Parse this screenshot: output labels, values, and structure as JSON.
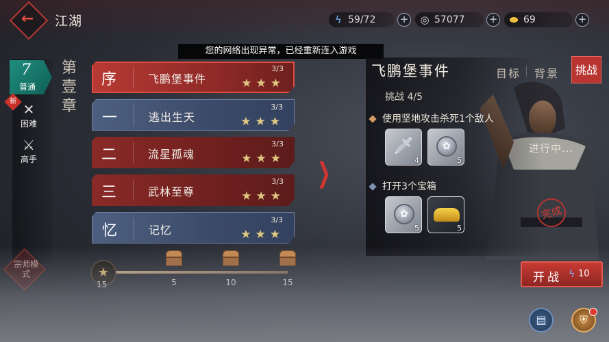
{
  "header": {
    "title": "江湖",
    "energy": "59/72",
    "coins": "57077",
    "gold": "69"
  },
  "notice": "您的网络出现异常，已经重新连入游戏",
  "difficulty": {
    "normal": "普通",
    "hard": "困难",
    "expert": "高手",
    "new_badge": "新"
  },
  "chapter_title": "第壹章",
  "master_mode": "宗师模式",
  "stages": [
    {
      "num": "序",
      "name": "飞鹏堡事件",
      "progress": "3/3",
      "stars": "★★★"
    },
    {
      "num": "一",
      "name": "逃出生天",
      "progress": "3/3",
      "stars": "★★★"
    },
    {
      "num": "二",
      "name": "流星孤魂",
      "progress": "3/3",
      "stars": "★★★"
    },
    {
      "num": "三",
      "name": "武林至尊",
      "progress": "3/3",
      "stars": "★★★"
    },
    {
      "num": "忆",
      "name": "记忆",
      "progress": "3/3",
      "stars": "★★★"
    }
  ],
  "star_progress": {
    "current": "15",
    "milestones": [
      "5",
      "10",
      "15"
    ]
  },
  "detail": {
    "title": "飞鹏堡事件",
    "tabs": {
      "goal": "目标",
      "background": "背景",
      "challenge": "挑战"
    },
    "challenge_label": "挑战",
    "challenge_count": "4/5",
    "goals": [
      {
        "text": "使用坚地攻击杀死1个敌人",
        "rewards": [
          "4",
          "5"
        ]
      },
      {
        "text": "打开3个宝箱",
        "rewards": [
          "5",
          "5"
        ]
      }
    ],
    "status": "进行中...",
    "seal": "完成"
  },
  "start_button": {
    "label": "开战",
    "cost": "10"
  },
  "colors": {
    "accent_red": "#b83530",
    "teal_tab": "#1f8f7f",
    "star_gold": "#e0c883"
  }
}
